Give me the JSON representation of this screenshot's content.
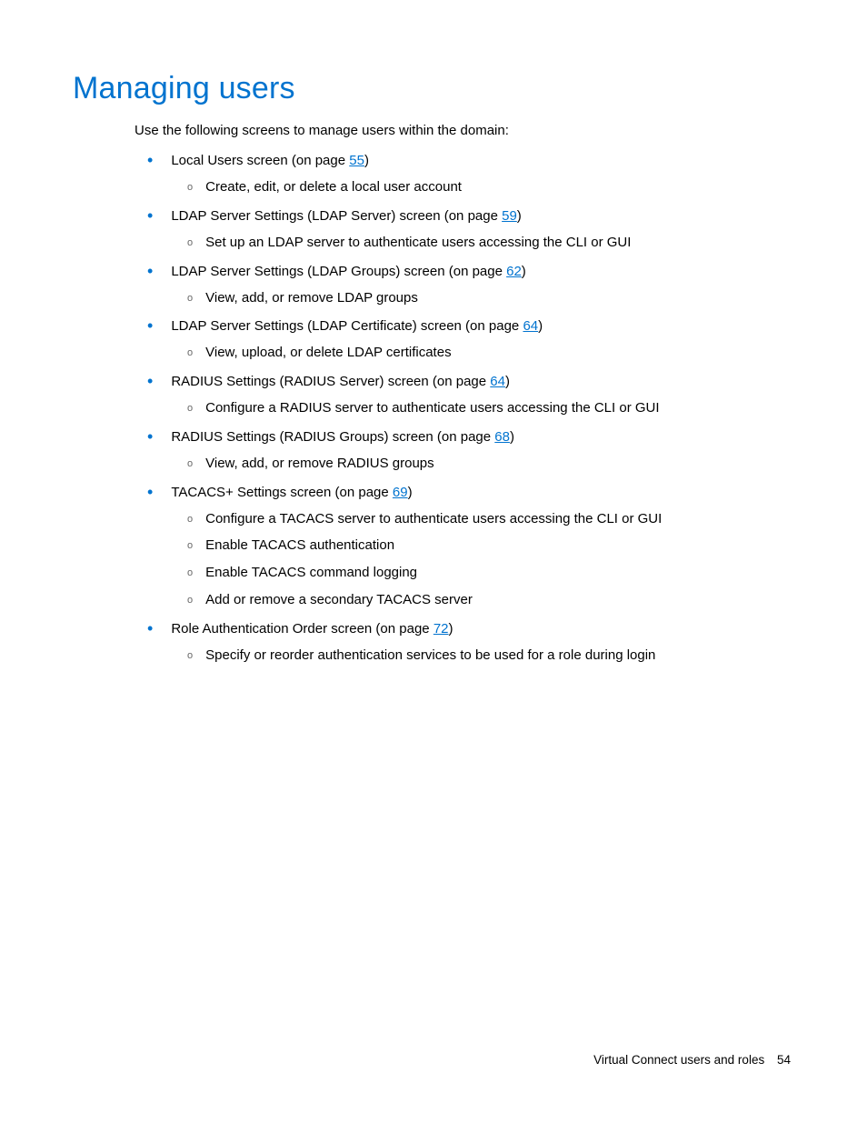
{
  "heading": "Managing users",
  "intro": "Use the following screens to manage users within the domain:",
  "items": [
    {
      "prefix": "Local Users screen (on page ",
      "page": "55",
      "suffix": ")",
      "subs": [
        "Create, edit, or delete a local user account"
      ]
    },
    {
      "prefix": "LDAP Server Settings (LDAP Server) screen (on page ",
      "page": "59",
      "suffix": ")",
      "subs": [
        "Set up an LDAP server to authenticate users accessing the CLI or GUI"
      ]
    },
    {
      "prefix": "LDAP Server Settings (LDAP Groups) screen (on page ",
      "page": "62",
      "suffix": ")",
      "subs": [
        "View, add, or remove LDAP groups"
      ]
    },
    {
      "prefix": "LDAP Server Settings (LDAP Certificate) screen (on page ",
      "page": "64",
      "suffix": ")",
      "subs": [
        "View, upload, or delete LDAP certificates"
      ]
    },
    {
      "prefix": "RADIUS Settings (RADIUS Server) screen (on page ",
      "page": "64",
      "suffix": ")",
      "subs": [
        "Configure a RADIUS server to authenticate users accessing the CLI or GUI"
      ]
    },
    {
      "prefix": "RADIUS Settings (RADIUS Groups) screen (on page ",
      "page": "68",
      "suffix": ")",
      "subs": [
        "View, add, or remove RADIUS groups"
      ]
    },
    {
      "prefix": "TACACS+ Settings screen (on page ",
      "page": "69",
      "suffix": ")",
      "subs": [
        "Configure a TACACS server to authenticate users accessing the CLI or GUI",
        "Enable TACACS authentication",
        "Enable TACACS command logging",
        "Add or remove a secondary TACACS server"
      ]
    },
    {
      "prefix": "Role Authentication Order screen (on page ",
      "page": "72",
      "suffix": ")",
      "subs": [
        "Specify or reorder authentication services to be used for a role during login"
      ]
    }
  ],
  "footer_text": "Virtual Connect users and roles",
  "footer_page": "54"
}
